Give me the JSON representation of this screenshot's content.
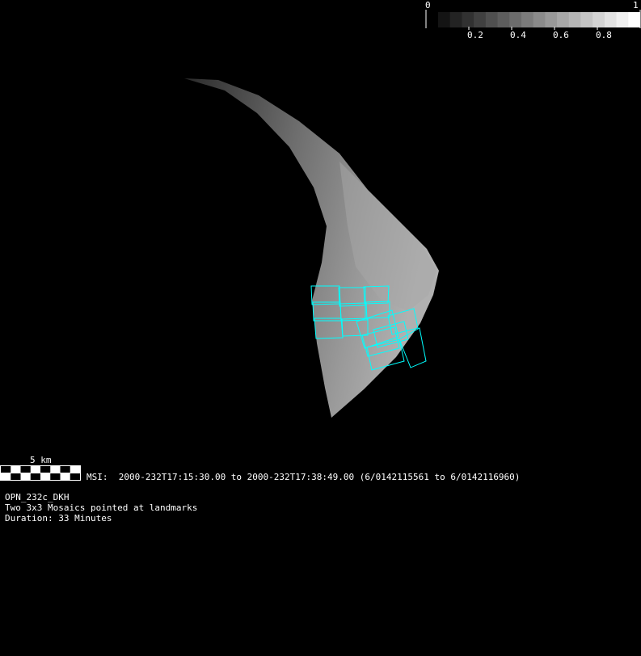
{
  "colorbar": {
    "min_label": "0",
    "max_label": "1",
    "ticks": [
      "0.2",
      "0.4",
      "0.6",
      "0.8"
    ],
    "steps": 17
  },
  "scale_bar": {
    "label": "5 km",
    "segments": 8
  },
  "msi_line": "MSI:  2000-232T17:15:30.00 to 2000-232T17:38:49.00 (6/0142115561 to 6/0142116960)",
  "observation": {
    "name": "OPN_232c_DKH",
    "description": "Two 3x3 Mosaics pointed at landmarks",
    "duration": "Duration: 33 Minutes"
  },
  "colors": {
    "footprint": "#00ffff",
    "background": "#000000"
  }
}
